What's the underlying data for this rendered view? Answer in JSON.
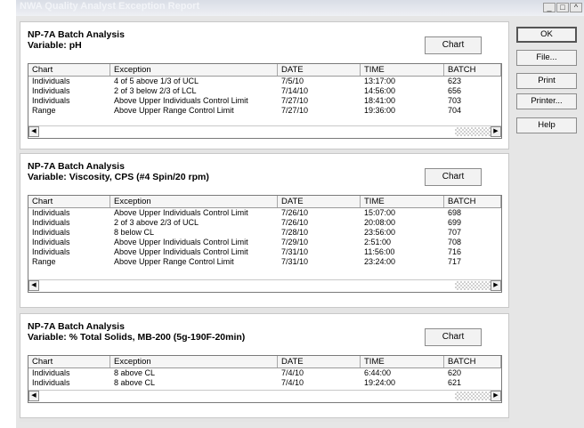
{
  "window": {
    "title": "NWA Quality Analyst Exception Report",
    "controls": [
      "_",
      "□",
      "^"
    ]
  },
  "columns": [
    "Chart",
    "Exception",
    "DATE",
    "TIME",
    "BATCH"
  ],
  "chart_button_label": "Chart",
  "side_buttons": {
    "ok": "OK",
    "file": "File...",
    "print": "Print",
    "printer": "Printer...",
    "help": "Help"
  },
  "panels": [
    {
      "title": "NP-7A Batch Analysis",
      "variable": "Variable: pH",
      "rows": [
        [
          "Individuals",
          "4 of 5 above 1/3 of UCL",
          "7/5/10",
          "13:17:00",
          "623"
        ],
        [
          "Individuals",
          "2 of 3 below 2/3 of LCL",
          "7/14/10",
          "14:56:00",
          "656"
        ],
        [
          "Individuals",
          "Above Upper Individuals Control Limit",
          "7/27/10",
          "18:41:00",
          "703"
        ],
        [
          "Range",
          "Above Upper Range Control Limit",
          "7/27/10",
          "19:36:00",
          "704"
        ]
      ]
    },
    {
      "title": "NP-7A Batch Analysis",
      "variable": "Variable: Viscosity, CPS (#4 Spin/20 rpm)",
      "rows": [
        [
          "Individuals",
          "Above Upper Individuals Control Limit",
          "7/26/10",
          "15:07:00",
          "698"
        ],
        [
          "Individuals",
          "2 of 3 above 2/3 of UCL",
          "7/26/10",
          "20:08:00",
          "699"
        ],
        [
          "Individuals",
          "8 below CL",
          "7/28/10",
          "23:56:00",
          "707"
        ],
        [
          "Individuals",
          "Above Upper Individuals Control Limit",
          "7/29/10",
          "2:51:00",
          "708"
        ],
        [
          "Individuals",
          "Above Upper Individuals Control Limit",
          "7/31/10",
          "11:56:00",
          "716"
        ],
        [
          "Range",
          "Above Upper Range Control Limit",
          "7/31/10",
          "23:24:00",
          "717"
        ]
      ]
    },
    {
      "title": "NP-7A Batch Analysis",
      "variable": "Variable: % Total Solids, MB-200 (5g-190F-20min)",
      "rows": [
        [
          "Individuals",
          "8 above CL",
          "7/4/10",
          "6:44:00",
          "620"
        ],
        [
          "Individuals",
          "8 above CL",
          "7/4/10",
          "19:24:00",
          "621"
        ]
      ]
    }
  ]
}
